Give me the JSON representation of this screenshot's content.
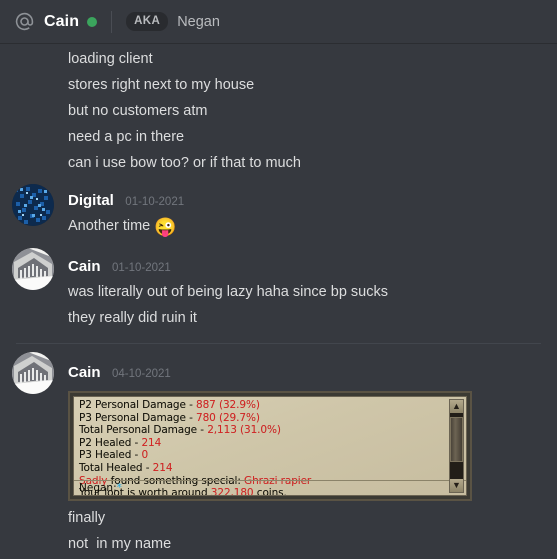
{
  "header": {
    "at_icon": "at-icon",
    "name": "Cain",
    "status": "online",
    "status_color": "#3ba55d",
    "aka_badge": "AKA",
    "aka_name": "Negan"
  },
  "messages": {
    "continued_lines": [
      "loading client",
      "stores right next to my house",
      "but no customers atm",
      "need a pc in there",
      "can i use bow too? or if that to much"
    ],
    "groups": [
      {
        "author": "Digital",
        "timestamp": "01-10-2021",
        "avatar": "digital-avatar",
        "lines": [
          "Another time "
        ],
        "emoji": "😜"
      },
      {
        "author": "Cain",
        "timestamp": "01-10-2021",
        "avatar": "cain-avatar",
        "lines": [
          "was literally out of being lazy haha since bp sucks",
          "they really did ruin it"
        ]
      },
      {
        "author": "Cain",
        "timestamp": "04-10-2021",
        "avatar": "cain-avatar",
        "lines": [
          "finally",
          "not  in my name"
        ]
      }
    ]
  },
  "game_log": {
    "lines": [
      {
        "label": "P2 Personal Damage - ",
        "value": "887 (32.9%)"
      },
      {
        "label": "P3 Personal Damage - ",
        "value": "780 (29.7%)"
      },
      {
        "label": "Total Personal Damage - ",
        "value": "2,113 (31.0%)"
      },
      {
        "label": "P2 Healed - ",
        "value": "214"
      },
      {
        "label": "P3 Healed - ",
        "value": "0"
      },
      {
        "label": "Total Healed - ",
        "value": "214"
      }
    ],
    "special_prefix": "Sadly",
    "special_mid": " found something special: ",
    "special_item": "Ghrazi rapier",
    "loot_pre": "Your loot is worth around ",
    "loot_value": "322,180",
    "loot_post": " coins.",
    "chat_name": "Negan:",
    "chat_cursor": "*",
    "scroll_up": "▲",
    "scroll_down": "▼"
  }
}
